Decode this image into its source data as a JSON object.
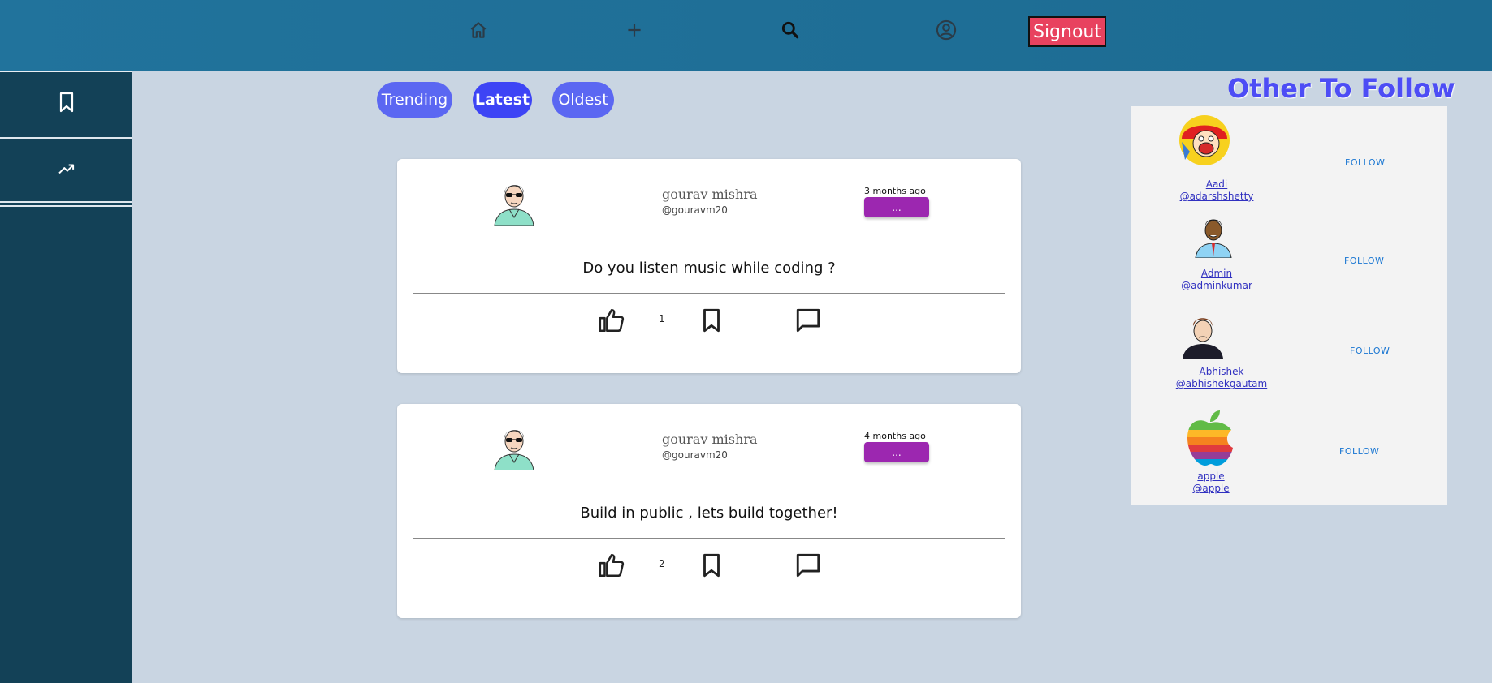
{
  "header": {
    "icons": [
      "home-icon",
      "plus-icon",
      "search-icon",
      "account-icon"
    ],
    "signout_label": "Signout"
  },
  "sidebar": {
    "items": [
      {
        "icon": "bookmark-icon"
      },
      {
        "icon": "trending-icon"
      }
    ]
  },
  "filters": [
    "Trending",
    "Latest",
    "Oldest"
  ],
  "posts": [
    {
      "name": "gourav mishra",
      "handle": "@gouravm20",
      "time": "3 months ago",
      "more_label": "...",
      "content": "Do you listen music while coding ?",
      "likes": "1"
    },
    {
      "name": "gourav mishra",
      "handle": "@gouravm20",
      "time": "4 months ago",
      "more_label": "...",
      "content": "Build in public , lets build together!",
      "likes": "2"
    }
  ],
  "follow": {
    "title": "Other To Follow",
    "users": [
      {
        "name": "Aadi",
        "handle": "@adarshshetty",
        "button": "FOLLOW"
      },
      {
        "name": "Admin",
        "handle": "@adminkumar",
        "button": "FOLLOW"
      },
      {
        "name": "Abhishek",
        "handle": "@abhishekgautam",
        "button": "FOLLOW"
      },
      {
        "name": "apple",
        "handle": "@apple",
        "button": "FOLLOW"
      }
    ]
  },
  "colors": {
    "topbar": "#21739c",
    "sidebar": "#134157",
    "signout": "#e8425f",
    "chip": "#5b67f2",
    "chip_active": "#3d44f5",
    "more_button": "#9c27b0",
    "follow_title": "#4d4df5"
  }
}
